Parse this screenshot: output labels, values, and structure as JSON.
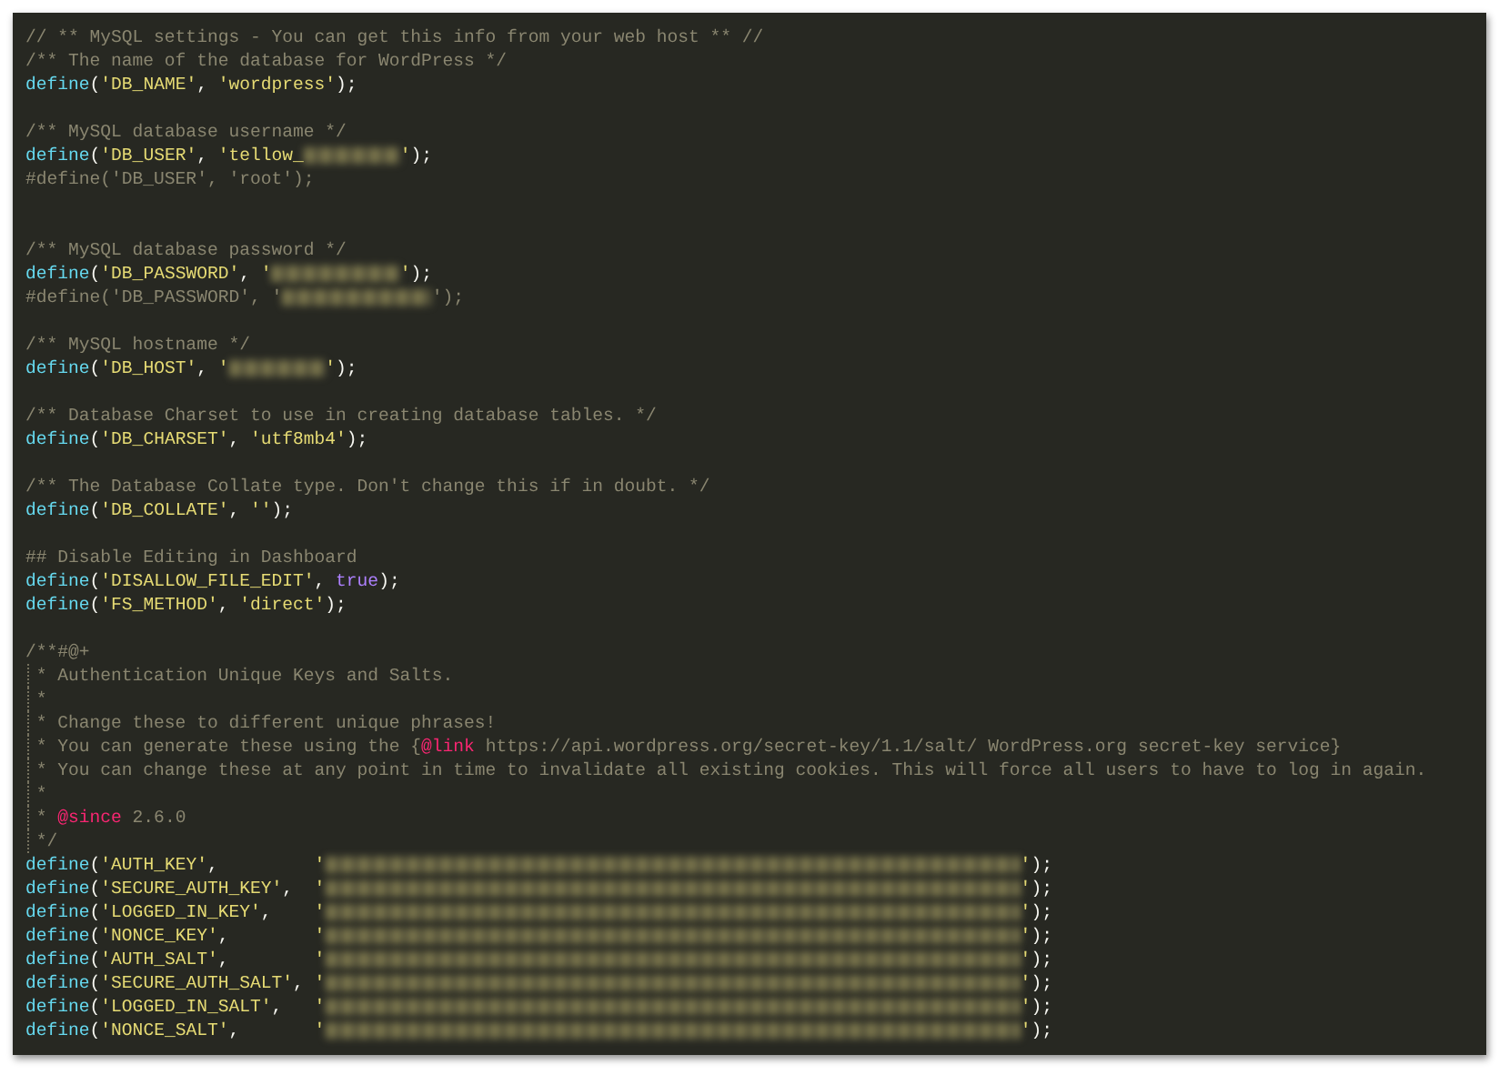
{
  "editor": {
    "lines": [
      {
        "kind": "code",
        "tokens": [
          {
            "kind": "comment",
            "text": "// ** MySQL settings - You can get this info from your web host ** //"
          }
        ]
      },
      {
        "kind": "code",
        "tokens": [
          {
            "kind": "comment",
            "text": "/** The name of the database for WordPress */"
          }
        ]
      },
      {
        "kind": "code",
        "tokens": [
          {
            "kind": "function",
            "text": "define"
          },
          {
            "kind": "punct",
            "text": "("
          },
          {
            "kind": "string",
            "text": "'DB_NAME'"
          },
          {
            "kind": "punct",
            "text": ", "
          },
          {
            "kind": "string",
            "text": "'wordpress'"
          },
          {
            "kind": "punct",
            "text": ");"
          }
        ]
      },
      {
        "kind": "blank"
      },
      {
        "kind": "code",
        "tokens": [
          {
            "kind": "comment",
            "text": "/** MySQL database username */"
          }
        ]
      },
      {
        "kind": "code",
        "tokens": [
          {
            "kind": "function",
            "text": "define"
          },
          {
            "kind": "punct",
            "text": "("
          },
          {
            "kind": "string",
            "text": "'DB_USER'"
          },
          {
            "kind": "punct",
            "text": ", "
          },
          {
            "kind": "string",
            "text": "'tellow_"
          },
          {
            "kind": "blurshort"
          },
          {
            "kind": "string",
            "text": "'"
          },
          {
            "kind": "punct",
            "text": ");"
          }
        ]
      },
      {
        "kind": "code",
        "tokens": [
          {
            "kind": "comment",
            "text": "#define('DB_USER', 'root');"
          }
        ]
      },
      {
        "kind": "blank"
      },
      {
        "kind": "blank"
      },
      {
        "kind": "code",
        "tokens": [
          {
            "kind": "comment",
            "text": "/** MySQL database password */"
          }
        ]
      },
      {
        "kind": "code",
        "tokens": [
          {
            "kind": "function",
            "text": "define"
          },
          {
            "kind": "punct",
            "text": "("
          },
          {
            "kind": "string",
            "text": "'DB_PASSWORD'"
          },
          {
            "kind": "punct",
            "text": ", "
          },
          {
            "kind": "string",
            "text": "'"
          },
          {
            "kind": "blurmedium"
          },
          {
            "kind": "string",
            "text": "'"
          },
          {
            "kind": "punct",
            "text": ");"
          }
        ]
      },
      {
        "kind": "code",
        "tokens": [
          {
            "kind": "comment",
            "text": "#define('DB_PASSWORD', '"
          },
          {
            "kind": "blurlong"
          },
          {
            "kind": "comment",
            "text": "');"
          }
        ]
      },
      {
        "kind": "blank"
      },
      {
        "kind": "code",
        "tokens": [
          {
            "kind": "comment",
            "text": "/** MySQL hostname */"
          }
        ]
      },
      {
        "kind": "code",
        "tokens": [
          {
            "kind": "function",
            "text": "define"
          },
          {
            "kind": "punct",
            "text": "("
          },
          {
            "kind": "string",
            "text": "'DB_HOST'"
          },
          {
            "kind": "punct",
            "text": ", "
          },
          {
            "kind": "string",
            "text": "'"
          },
          {
            "kind": "blurshort"
          },
          {
            "kind": "string",
            "text": "'"
          },
          {
            "kind": "punct",
            "text": ");"
          }
        ]
      },
      {
        "kind": "blank"
      },
      {
        "kind": "code",
        "tokens": [
          {
            "kind": "comment",
            "text": "/** Database Charset to use in creating database tables. */"
          }
        ]
      },
      {
        "kind": "code",
        "tokens": [
          {
            "kind": "function",
            "text": "define"
          },
          {
            "kind": "punct",
            "text": "("
          },
          {
            "kind": "string",
            "text": "'DB_CHARSET'"
          },
          {
            "kind": "punct",
            "text": ", "
          },
          {
            "kind": "string",
            "text": "'utf8mb4'"
          },
          {
            "kind": "punct",
            "text": ");"
          }
        ]
      },
      {
        "kind": "blank"
      },
      {
        "kind": "code",
        "tokens": [
          {
            "kind": "comment",
            "text": "/** The Database Collate type. Don't change this if in doubt. */"
          }
        ]
      },
      {
        "kind": "code",
        "tokens": [
          {
            "kind": "function",
            "text": "define"
          },
          {
            "kind": "punct",
            "text": "("
          },
          {
            "kind": "string",
            "text": "'DB_COLLATE'"
          },
          {
            "kind": "punct",
            "text": ", "
          },
          {
            "kind": "string",
            "text": "''"
          },
          {
            "kind": "punct",
            "text": ");"
          }
        ]
      },
      {
        "kind": "blank"
      },
      {
        "kind": "code",
        "tokens": [
          {
            "kind": "comment",
            "text": "## Disable Editing in Dashboard"
          }
        ]
      },
      {
        "kind": "code",
        "tokens": [
          {
            "kind": "function",
            "text": "define"
          },
          {
            "kind": "punct",
            "text": "("
          },
          {
            "kind": "string",
            "text": "'DISALLOW_FILE_EDIT'"
          },
          {
            "kind": "punct",
            "text": ", "
          },
          {
            "kind": "constant",
            "text": "true"
          },
          {
            "kind": "punct",
            "text": ");"
          }
        ]
      },
      {
        "kind": "code",
        "tokens": [
          {
            "kind": "function",
            "text": "define"
          },
          {
            "kind": "punct",
            "text": "("
          },
          {
            "kind": "string",
            "text": "'FS_METHOD'"
          },
          {
            "kind": "punct",
            "text": ", "
          },
          {
            "kind": "string",
            "text": "'direct'"
          },
          {
            "kind": "punct",
            "text": ");"
          }
        ]
      },
      {
        "kind": "blank"
      },
      {
        "kind": "code",
        "tokens": [
          {
            "kind": "comment",
            "text": "/**#@+"
          }
        ]
      },
      {
        "kind": "doc",
        "tokens": [
          {
            "kind": "comment",
            "text": " * Authentication Unique Keys and Salts."
          }
        ]
      },
      {
        "kind": "doc",
        "tokens": [
          {
            "kind": "comment",
            "text": " *"
          }
        ]
      },
      {
        "kind": "doc",
        "tokens": [
          {
            "kind": "comment",
            "text": " * Change these to different unique phrases!"
          }
        ]
      },
      {
        "kind": "doc",
        "tokens": [
          {
            "kind": "comment",
            "text": " * You can generate these using the {"
          },
          {
            "kind": "tag",
            "text": "@link"
          },
          {
            "kind": "comment",
            "text": " https://api.wordpress.org/secret-key/1.1/salt/ WordPress.org secret-key service}"
          }
        ]
      },
      {
        "kind": "doc",
        "tokens": [
          {
            "kind": "comment",
            "text": " * You can change these at any point in time to invalidate all existing cookies. This will force all users to have to log in again."
          }
        ]
      },
      {
        "kind": "doc",
        "tokens": [
          {
            "kind": "comment",
            "text": " *"
          }
        ]
      },
      {
        "kind": "doc",
        "tokens": [
          {
            "kind": "comment",
            "text": " * "
          },
          {
            "kind": "tag",
            "text": "@since"
          },
          {
            "kind": "comment",
            "text": " 2.6.0"
          }
        ]
      },
      {
        "kind": "doc",
        "tokens": [
          {
            "kind": "comment",
            "text": " */"
          }
        ]
      },
      {
        "kind": "code",
        "tokens": [
          {
            "kind": "function",
            "text": "define"
          },
          {
            "kind": "punct",
            "text": "("
          },
          {
            "kind": "string",
            "text": "'AUTH_KEY'"
          },
          {
            "kind": "punct",
            "text": ",         "
          },
          {
            "kind": "string",
            "text": "'"
          },
          {
            "kind": "blurkey"
          },
          {
            "kind": "string",
            "text": "'"
          },
          {
            "kind": "punct",
            "text": ");"
          }
        ]
      },
      {
        "kind": "code",
        "tokens": [
          {
            "kind": "function",
            "text": "define"
          },
          {
            "kind": "punct",
            "text": "("
          },
          {
            "kind": "string",
            "text": "'SECURE_AUTH_KEY'"
          },
          {
            "kind": "punct",
            "text": ",  "
          },
          {
            "kind": "string",
            "text": "'"
          },
          {
            "kind": "blurkey"
          },
          {
            "kind": "string",
            "text": "'"
          },
          {
            "kind": "punct",
            "text": ");"
          }
        ]
      },
      {
        "kind": "code",
        "tokens": [
          {
            "kind": "function",
            "text": "define"
          },
          {
            "kind": "punct",
            "text": "("
          },
          {
            "kind": "string",
            "text": "'LOGGED_IN_KEY'"
          },
          {
            "kind": "punct",
            "text": ",    "
          },
          {
            "kind": "string",
            "text": "'"
          },
          {
            "kind": "blurkey"
          },
          {
            "kind": "string",
            "text": "'"
          },
          {
            "kind": "punct",
            "text": ");"
          }
        ]
      },
      {
        "kind": "code",
        "tokens": [
          {
            "kind": "function",
            "text": "define"
          },
          {
            "kind": "punct",
            "text": "("
          },
          {
            "kind": "string",
            "text": "'NONCE_KEY'"
          },
          {
            "kind": "punct",
            "text": ",        "
          },
          {
            "kind": "string",
            "text": "'"
          },
          {
            "kind": "blurkey"
          },
          {
            "kind": "string",
            "text": "'"
          },
          {
            "kind": "punct",
            "text": ");"
          }
        ]
      },
      {
        "kind": "code",
        "tokens": [
          {
            "kind": "function",
            "text": "define"
          },
          {
            "kind": "punct",
            "text": "("
          },
          {
            "kind": "string",
            "text": "'AUTH_SALT'"
          },
          {
            "kind": "punct",
            "text": ",        "
          },
          {
            "kind": "string",
            "text": "'"
          },
          {
            "kind": "blurkey"
          },
          {
            "kind": "string",
            "text": "'"
          },
          {
            "kind": "punct",
            "text": ");"
          }
        ]
      },
      {
        "kind": "code",
        "tokens": [
          {
            "kind": "function",
            "text": "define"
          },
          {
            "kind": "punct",
            "text": "("
          },
          {
            "kind": "string",
            "text": "'SECURE_AUTH_SALT'"
          },
          {
            "kind": "punct",
            "text": ", "
          },
          {
            "kind": "string",
            "text": "'"
          },
          {
            "kind": "blurkey"
          },
          {
            "kind": "string",
            "text": "'"
          },
          {
            "kind": "punct",
            "text": ");"
          }
        ]
      },
      {
        "kind": "code",
        "tokens": [
          {
            "kind": "function",
            "text": "define"
          },
          {
            "kind": "punct",
            "text": "("
          },
          {
            "kind": "string",
            "text": "'LOGGED_IN_SALT'"
          },
          {
            "kind": "punct",
            "text": ",   "
          },
          {
            "kind": "string",
            "text": "'"
          },
          {
            "kind": "blurkey"
          },
          {
            "kind": "string",
            "text": "'"
          },
          {
            "kind": "punct",
            "text": ");"
          }
        ]
      },
      {
        "kind": "code",
        "tokens": [
          {
            "kind": "function",
            "text": "define"
          },
          {
            "kind": "punct",
            "text": "("
          },
          {
            "kind": "string",
            "text": "'NONCE_SALT'"
          },
          {
            "kind": "punct",
            "text": ",       "
          },
          {
            "kind": "string",
            "text": "'"
          },
          {
            "kind": "blurkey"
          },
          {
            "kind": "string",
            "text": "'"
          },
          {
            "kind": "punct",
            "text": ");"
          }
        ]
      }
    ]
  }
}
